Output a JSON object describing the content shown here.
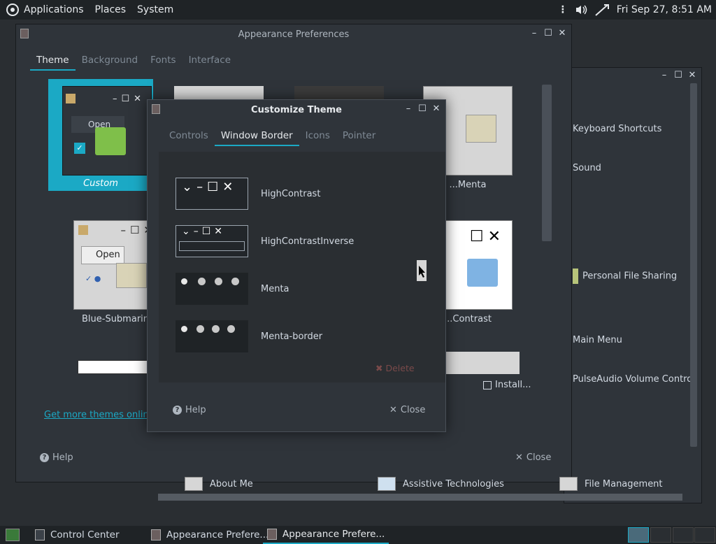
{
  "top_panel": {
    "applications": "Applications",
    "places": "Places",
    "system": "System",
    "clock": "Fri Sep 27,  8:51 AM"
  },
  "control_center": {
    "items": [
      "Keyboard Shortcuts",
      "Sound",
      "Personal File Sharing",
      "Main Menu",
      "PulseAudio Volume Control"
    ]
  },
  "appearance": {
    "title": "Appearance Preferences",
    "tabs": [
      "Theme",
      "Background",
      "Fonts",
      "Interface"
    ],
    "active_tab": "Theme",
    "themes": {
      "custom": "Custom",
      "menta": "...Menta",
      "blue_submarine": "Blue-Submarine",
      "contrast": "...Contrast"
    },
    "custom_open_label": "Open",
    "blue_open_label": "Open",
    "install_label": "Install...",
    "more_themes_link": "Get more themes online",
    "help_label": "Help",
    "close_label": "Close"
  },
  "customize": {
    "title": "Customize Theme",
    "tabs": [
      "Controls",
      "Window Border",
      "Icons",
      "Pointer"
    ],
    "active_tab": "Window Border",
    "borders": [
      "HighContrast",
      "HighContrastInverse",
      "Menta",
      "Menta-border"
    ],
    "delete_label": "Delete",
    "help_label": "Help",
    "close_label": "Close"
  },
  "bottom_strip": {
    "items": [
      "About Me",
      "Assistive Technologies",
      "File Management"
    ]
  },
  "taskbar": {
    "tasks": [
      "Control Center",
      "Appearance Prefere...",
      "Appearance Prefere..."
    ]
  },
  "colors": {
    "accent": "#1ba9c5",
    "panel_bg": "#1f2326",
    "window_bg": "#2f343a"
  }
}
